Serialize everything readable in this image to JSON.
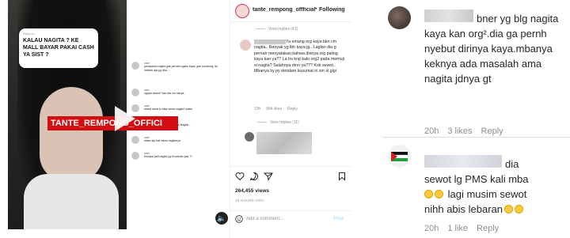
{
  "post": {
    "video": {
      "reply_card": {
        "reply_to": "Reply to",
        "text": "KALAU NAGITA ? KE MALL BAYAR PAKAI CASH YA SIST ?"
      },
      "watermark": "TANTE_REMPONG_OFFICI",
      "comments": [
        {
          "user": "user",
          "text": "penasaran nagita gak pernah ngaku kaya, gak sombong, itu netizen aja yg nilai..."
        },
        {
          "user": "user",
          "text": "ngapa sewot? kan dia cm nanya.."
        },
        {
          "user": "user",
          "text": "sewot amat lu mba sama nagita? kwkw"
        },
        {
          "user": "user",
          "text": "punya masalah apa ya sama Nagita..."
        },
        {
          "user": "user",
          "text": "biasa aja kali sama nagitanya"
        },
        {
          "user": "user",
          "text": "Kenapa jadi nagita yg di sudutin yaa ??"
        }
      ]
    },
    "sidebar": {
      "account": "tante_rempong_offficial",
      "follow_dot": "•",
      "follow_label": "Following",
      "view_replies_1": "View replies (43)",
      "comment1": {
        "text": "Ya emang org kaya bkn cm nagita.. Banyak yg lbh kaya jg.. Laglan dia g pernah menyatakan bahwa dirinya org paling kaya kan ya?? La trs knp kalo org2 pada memuji si nagita? Salahnya dmn ya??? Kok sewot.. Mbanya ky py dendam kusumat ni sm si gigi",
        "time": "19h",
        "likes": "844 likes",
        "reply": "Reply"
      },
      "view_replies_2": "View replies (11)",
      "views": "264,455 views",
      "time_ago": "19 HOURS AGO",
      "comment_placeholder": "Add a comment...",
      "post_button": "Post"
    }
  },
  "zoom": {
    "comment1": {
      "text": "bner yg blg nagita kaya kan org².dia ga pernh nyebut dirinya kaya.mbanya keknya ada masalah ama nagita jdnya gt",
      "time": "20h",
      "likes": "3 likes",
      "reply": "Reply"
    },
    "comment2": {
      "line1": "dia",
      "line2": "sewot lg PMS kali mba",
      "line3": "lagi musim sewot",
      "line4": "nihh abis lebaran",
      "time": "20h",
      "likes": "1 like",
      "reply": "Reply"
    }
  },
  "colors": {
    "watermark_red": "#d40d12",
    "meta_gray": "#8e8e8e",
    "post_button_blue": "#b2dffc",
    "story_ring": "#e1306c"
  }
}
